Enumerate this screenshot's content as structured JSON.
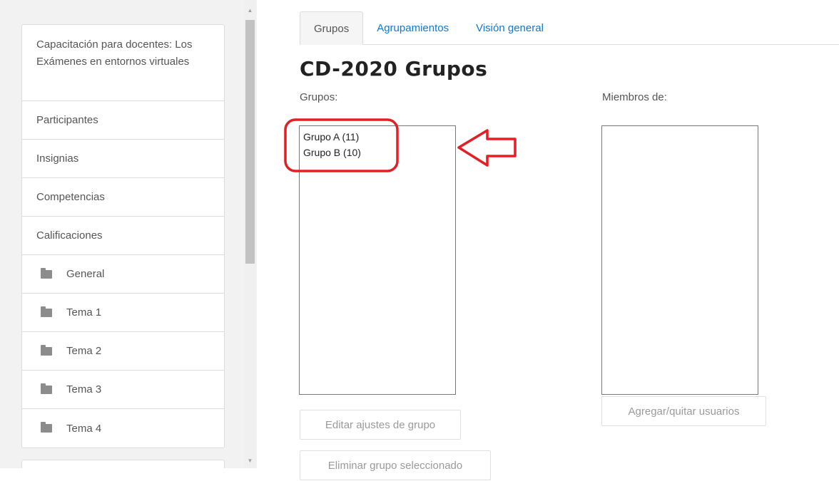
{
  "sidebar": {
    "course_title": "Capacitación para docentes: Los Exámenes en entornos virtuales",
    "items": [
      {
        "label": "Participantes"
      },
      {
        "label": "Insignias"
      },
      {
        "label": "Competencias"
      },
      {
        "label": "Calificaciones"
      }
    ],
    "sections": [
      {
        "label": "General",
        "icon": "folder-icon"
      },
      {
        "label": "Tema 1",
        "icon": "folder-icon"
      },
      {
        "label": "Tema 2",
        "icon": "folder-icon"
      },
      {
        "label": "Tema 3",
        "icon": "folder-icon"
      },
      {
        "label": "Tema 4",
        "icon": "folder-icon"
      }
    ]
  },
  "tabs": [
    {
      "label": "Grupos",
      "active": true
    },
    {
      "label": "Agrupamientos",
      "active": false
    },
    {
      "label": "Visión general",
      "active": false
    }
  ],
  "page_title": "CD-2020 Grupos",
  "groups_label": "Grupos:",
  "groups": [
    "Grupo A (11)",
    "Grupo B (10)"
  ],
  "members_label": "Miembros de:",
  "buttons": {
    "edit_group": "Editar ajustes de grupo",
    "delete_group": "Eliminar grupo seleccionado",
    "add_remove_users": "Agregar/quitar usuarios"
  },
  "colors": {
    "link": "#1177d1",
    "annotation": "#e31e24"
  }
}
